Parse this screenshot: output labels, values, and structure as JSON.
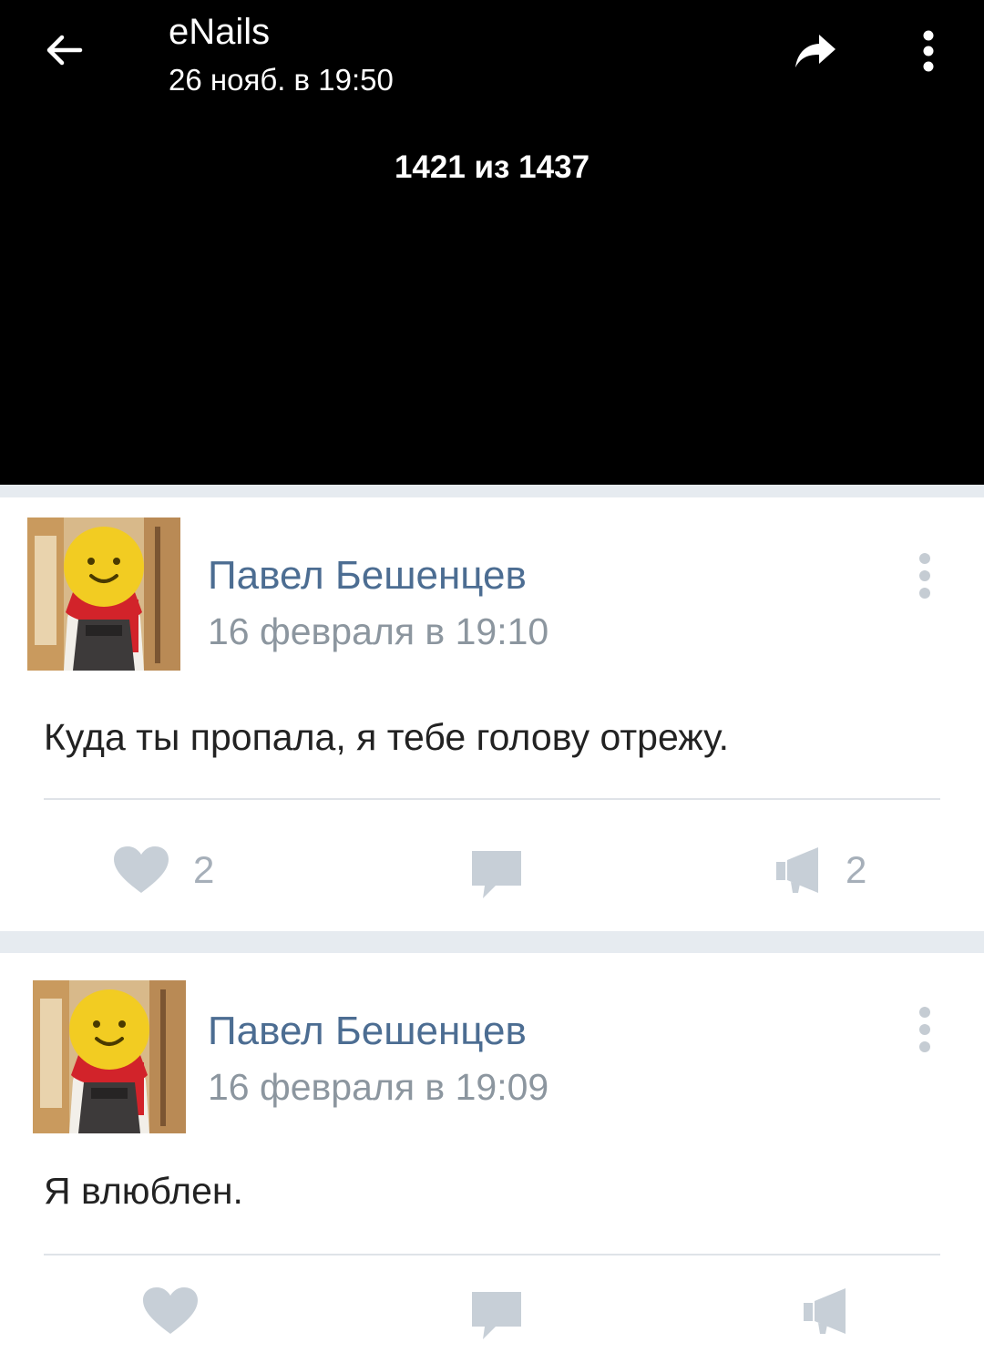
{
  "viewer": {
    "title": "eNails",
    "subtitle": "26 нояб. в 19:50",
    "counter": "1421 из 1437"
  },
  "icons": {
    "back": "arrow-left-icon",
    "share": "share-arrow-icon",
    "more": "more-vertical-icon",
    "like": "heart-icon",
    "comment": "comment-icon",
    "repost": "megaphone-icon"
  },
  "colors": {
    "author": "#4c6d92",
    "date": "#8c969f",
    "action": "#a6afb9",
    "feed_bg": "#e6ebf0"
  },
  "posts": [
    {
      "author": "Павел Бешенцев",
      "date": "16 февраля в 19:10",
      "text": "Куда ты пропала, я тебе голову отрежу.",
      "likes": "2",
      "reposts": "2"
    },
    {
      "author": "Павел Бешенцев",
      "date": "16 февраля в 19:09",
      "text": "Я влюблен."
    }
  ]
}
